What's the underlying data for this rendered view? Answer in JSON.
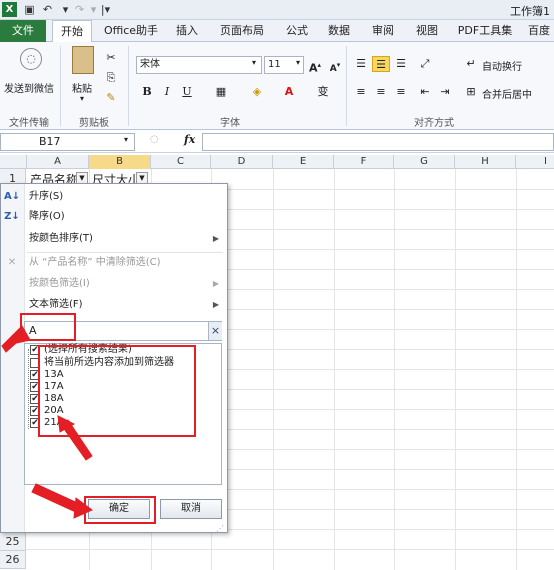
{
  "window": {
    "title": "工作簿1"
  },
  "quick_access": {
    "save_icon": "save-icon",
    "undo_icon": "undo-icon",
    "redo_icon": "redo-icon"
  },
  "tabs": [
    "文件",
    "开始",
    "Office助手",
    "插入",
    "页面布局",
    "公式",
    "数据",
    "审阅",
    "视图",
    "PDF工具集",
    "百度"
  ],
  "ribbon": {
    "send_wechat": "发送到微信",
    "paste": "粘贴",
    "group_file": "文件传输",
    "group_clipboard": "剪贴板",
    "font_name": "宋体",
    "font_size": "11",
    "bold": "B",
    "italic": "I",
    "underline": "U",
    "group_font": "字体",
    "wrap_text": "自动换行",
    "merge_center": "合并后居中",
    "group_alignment": "对齐方式",
    "fx": "fx"
  },
  "formula_bar": {
    "name_box": "B17"
  },
  "columns": [
    "A",
    "B",
    "C",
    "D",
    "E",
    "F",
    "G",
    "H",
    "I"
  ],
  "row1": {
    "num": "1",
    "a1": "产品名称",
    "b1": "尺寸大小"
  },
  "bottom_rows": [
    "25",
    "26"
  ],
  "filter_menu": {
    "sort_asc": "升序(S)",
    "sort_desc": "降序(O)",
    "sort_color": "按颜色排序(T)",
    "clear_filter": "从 “产品名称” 中清除筛选(C)",
    "filter_color": "按颜色筛选(I)",
    "text_filter": "文本筛选(F)",
    "search_value": "A",
    "items": [
      {
        "label": "(选择所有搜索结果)",
        "checked": true
      },
      {
        "label": "将当前所选内容添加到筛选器",
        "checked": false
      },
      {
        "label": "13A",
        "checked": true
      },
      {
        "label": "17A",
        "checked": true
      },
      {
        "label": "18A",
        "checked": true
      },
      {
        "label": "20A",
        "checked": true
      },
      {
        "label": "21A",
        "checked": true
      }
    ],
    "ok": "确定",
    "cancel": "取消"
  },
  "colors": {
    "accent_green": "#2a7b3d",
    "annotation_red": "#e31e24"
  }
}
